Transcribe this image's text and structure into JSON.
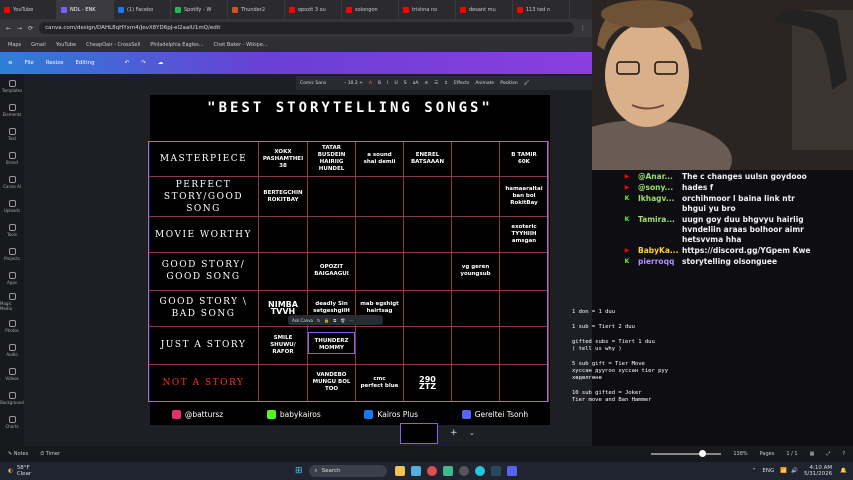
{
  "browser": {
    "tabs": [
      {
        "label": "YouTube",
        "color": "#ff0000"
      },
      {
        "label": "NDL - ENK",
        "color": "#7b5cff"
      },
      {
        "label": "(1) Facebo",
        "color": "#1877f2"
      },
      {
        "label": "Spotify - W",
        "color": "#1db954"
      },
      {
        "label": "Thunder2",
        "color": "#cc5522"
      },
      {
        "label": "opozit 3 ou",
        "color": "#ff0000"
      },
      {
        "label": "solongon",
        "color": "#ff0000"
      },
      {
        "label": "trishna no",
        "color": "#ff0000"
      },
      {
        "label": "desant mu",
        "color": "#ff0000"
      },
      {
        "label": "113 ted n",
        "color": "#ff0000"
      }
    ],
    "url": "canva.com/design/DAHL8qHYxm4/JevX8YD6pJ-el2aalU1mQ/edit",
    "bookmarks": [
      "Maps",
      "Gmail",
      "YouTube",
      "CheapOair - CrossSell",
      "Philadelphia Eagles...",
      "Chet Baker - Wikipe..."
    ]
  },
  "canva": {
    "menu": [
      "File",
      "Resize",
      "Editing"
    ],
    "rail": [
      "Templates",
      "Elements",
      "Text",
      "Brand",
      "Canva AI",
      "Uploads",
      "Tools",
      "Projects",
      "Apps",
      "Magic Media",
      "Photos",
      "Audio",
      "Videos",
      "Background",
      "Charts"
    ],
    "font": "Comic Sans",
    "font_size": "10.2",
    "toolbar": [
      "Effects",
      "Animate",
      "Position"
    ],
    "ask": "Ask Canva",
    "notes": "Notes",
    "timer": "Timer",
    "zoom": "138%",
    "pages": "Pages",
    "page_count": "1 / 1"
  },
  "design": {
    "title": "\"BEST STORYTELLING SONGS\"",
    "rows": [
      {
        "tier": "MASTERPIECE",
        "color": "#ffffff",
        "cells": [
          "XOKX\nPASHAMTHEI 38",
          "TATAR\nBUSDEIN\nHAIRIIG HUNDEL",
          "a sound\nshai demii",
          "ENEREL\nBATSAAAN",
          "",
          "B TAMIR\n60K"
        ]
      },
      {
        "tier": "PERFECT STORY/GOOD\nSONG",
        "color": "#ffffff",
        "cells": [
          "BERTEGCHIN\nROKITBAY",
          "",
          "",
          "",
          "",
          "hamaaraltai\nban bol\nRokitBay"
        ]
      },
      {
        "tier": "MOVIE WORTHY",
        "color": "#ffffff",
        "cells": [
          "",
          "",
          "",
          "",
          "",
          "exoteric\nTYYHIIH\namsgan"
        ]
      },
      {
        "tier": "GOOD STORY/\nGOOD SONG",
        "color": "#ffffff",
        "cells": [
          "",
          "OPOZIT\nBAIGAAGUI",
          "",
          "",
          "vg geren\nyoungsub",
          ""
        ]
      },
      {
        "tier": "GOOD STORY \\\nBAD SONG",
        "color": "#ffffff",
        "cells": [
          "NIMBA\nTVVH",
          "deadly Sin\nsetgeshgiiH",
          "mab egshigt\nhairtsag",
          "",
          "",
          ""
        ]
      },
      {
        "tier": "JUST A STORY",
        "color": "#ffffff",
        "cells": [
          "SMILE\nSHUWU/\nRAFOR",
          "THUNDERZ\nMOMMY",
          "",
          "",
          "",
          ""
        ]
      },
      {
        "tier": "NOT A STORY",
        "color": "#ff2a2a",
        "cells": [
          "",
          "VANDEBO\nMUNGU BOL\nTOO",
          "cmc\nperfect blue",
          "290\nZTZ",
          "",
          ""
        ]
      }
    ],
    "socials": [
      {
        "icon": "instagram-icon",
        "text": "@battursz",
        "color": "#e1306c"
      },
      {
        "icon": "kick-icon",
        "text": "babykairos",
        "color": "#53fc18"
      },
      {
        "icon": "facebook-icon",
        "text": "Kairos Plus",
        "color": "#1877f2"
      },
      {
        "icon": "discord-icon",
        "text": "Gereltei Tsonh",
        "color": "#5865f2"
      }
    ]
  },
  "chat": [
    {
      "badge": "▶",
      "bcolor": "#ff0000",
      "user": "@Anar...",
      "ucolor": "#9be06a",
      "text": "The c changes uulsn goydooo"
    },
    {
      "badge": "▶",
      "bcolor": "#ff0000",
      "user": "@sony...",
      "ucolor": "#9be06a",
      "text": "hades f"
    },
    {
      "badge": "K",
      "bcolor": "#53fc18",
      "user": "Ikhagv...",
      "ucolor": "#9be06a",
      "text": "orchihmoor l baina link ntr bhgui yu bro"
    },
    {
      "badge": "K",
      "bcolor": "#53fc18",
      "user": "Tamira...",
      "ucolor": "#9be06a",
      "text": "uugn goy duu bhgvyu hairiig hvndeliin araas bolhoor aimr hetsvvma hha"
    },
    {
      "badge": "▶",
      "bcolor": "#ff0000",
      "user": "BabyKa...",
      "ucolor": "#ffd23f",
      "text": "https://discord.gg/YGpem Kwe"
    },
    {
      "badge": "K",
      "bcolor": "#53fc18",
      "user": "pierroqq",
      "ucolor": "#b38cff",
      "text": "storytelling olsonguee"
    }
  ],
  "subs": [
    "1 don = 1 duu",
    "1 sub = Tiert 2 duu",
    "gifted subs = Tiert 1 duu\n( tell us why )",
    "5 sub gift = Tier Move\nхуссан дуугоо хуссан tier руу\nхөдөлгөнө",
    "10 sub gifted = Joker\nTier move and Ban Hammer"
  ],
  "taskbar": {
    "weather_temp": "58°F",
    "weather_desc": "Clear",
    "search": "Search",
    "lang": "ENG",
    "time": "4:10 AM",
    "date": "5/31/2026"
  }
}
